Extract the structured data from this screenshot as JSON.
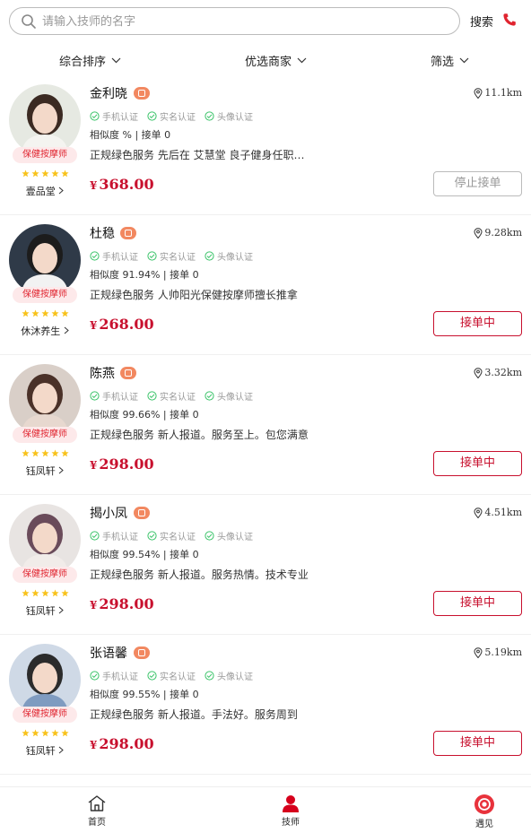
{
  "search": {
    "placeholder": "请输入技师的名字",
    "button_label": "搜索"
  },
  "filters": [
    {
      "label": "综合排序"
    },
    {
      "label": "优选商家"
    },
    {
      "label": "筛选"
    }
  ],
  "certs": [
    "手机认证",
    "实名认证",
    "头像认证"
  ],
  "technicians": [
    {
      "name": "金利晓",
      "distance": "11.1km",
      "meta": "相似度 % | 接单 0",
      "desc": "正规绿色服务 先后在 艾慧堂 良子健身任职，手法娴熟",
      "price": "368.00",
      "yen": "¥",
      "tag": "保健按摩师",
      "shop": "壹品堂",
      "action": "停止接单",
      "action_state": "stopped",
      "avatar_bg": "#e6e9e2",
      "hair": "#3b2a22",
      "shirt": "#f4f4f0"
    },
    {
      "name": "杜稳",
      "distance": "9.28km",
      "meta": "相似度 91.94% | 接单 0",
      "desc": "正规绿色服务 人帅阳光保健按摩师擅长推拿",
      "price": "268.00",
      "yen": "¥",
      "tag": "保健按摩师",
      "shop": "休沐养生",
      "action": "接单中",
      "action_state": "active",
      "avatar_bg": "#2f3a48",
      "hair": "#1c1c1c",
      "shirt": "#f2f2f2"
    },
    {
      "name": "陈燕",
      "distance": "3.32km",
      "meta": "相似度 99.66% | 接单 0",
      "desc": "正规绿色服务 新人报道。服务至上。包您满意",
      "price": "298.00",
      "yen": "¥",
      "tag": "保健按摩师",
      "shop": "钰凤轩",
      "action": "接单中",
      "action_state": "active",
      "avatar_bg": "#d9cfc8",
      "hair": "#4a3128",
      "shirt": "#e7d8cf"
    },
    {
      "name": "揭小凤",
      "distance": "4.51km",
      "meta": "相似度 99.54% | 接单 0",
      "desc": "正规绿色服务 新人报道。服务热情。技术专业",
      "price": "298.00",
      "yen": "¥",
      "tag": "保健按摩师",
      "shop": "钰凤轩",
      "action": "接单中",
      "action_state": "active",
      "avatar_bg": "#e8e4e2",
      "hair": "#6a4b5a",
      "shirt": "#f1ece9"
    },
    {
      "name": "张语馨",
      "distance": "5.19km",
      "meta": "相似度 99.55% | 接单 0",
      "desc": "正规绿色服务 新人报道。手法好。服务周到",
      "price": "298.00",
      "yen": "¥",
      "tag": "保健按摩师",
      "shop": "钰凤轩",
      "action": "接单中",
      "action_state": "active",
      "avatar_bg": "#cfd9e6",
      "hair": "#2b2b2b",
      "shirt": "#7f9bc0"
    }
  ],
  "tabs": [
    {
      "label": "首页",
      "icon": "home-icon"
    },
    {
      "label": "技师",
      "icon": "user-icon"
    },
    {
      "label": "遇见",
      "icon": "meet-icon"
    }
  ],
  "colors": {
    "accent": "#c8102e",
    "cert_green": "#3cc46a",
    "badge": "#f28860",
    "tag_bg": "#fde9ea",
    "star": "#f8c21b"
  }
}
